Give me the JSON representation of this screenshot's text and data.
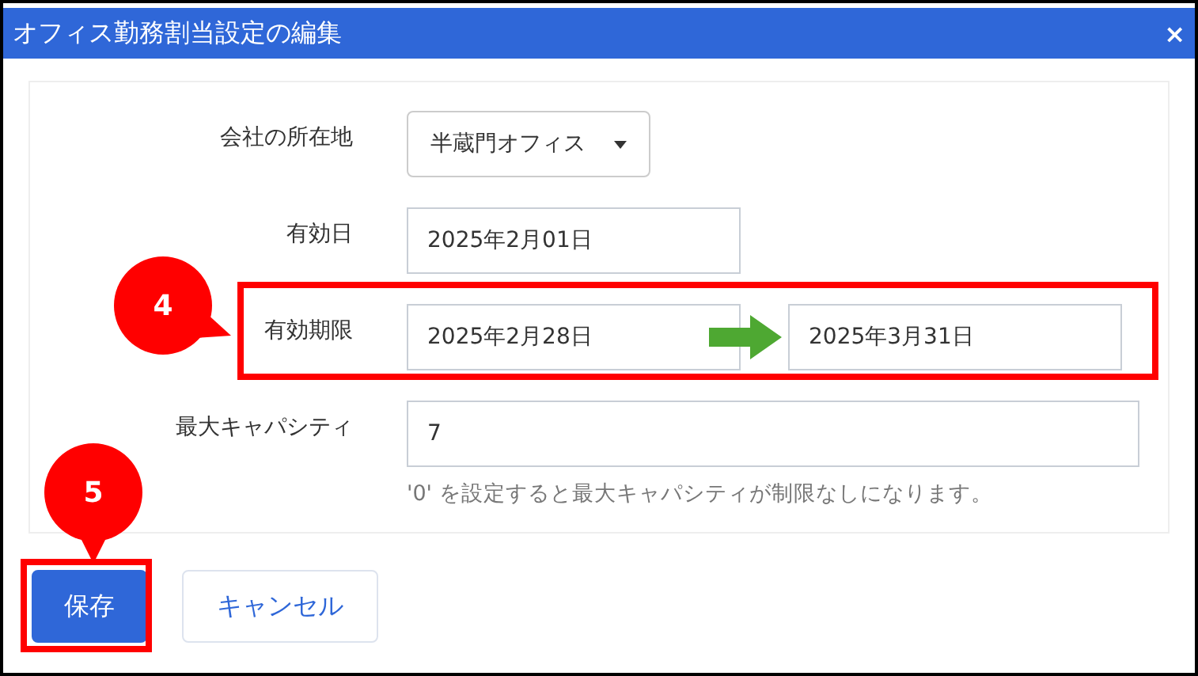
{
  "window": {
    "title": "オフィス勤務割当設定の編集",
    "close": "×"
  },
  "form": {
    "location": {
      "label": "会社の所在地",
      "value": "半蔵門オフィス"
    },
    "effective_date": {
      "label": "有効日",
      "value": "2025年2月01日"
    },
    "expiry": {
      "label": "有効期限",
      "from": "2025年2月28日",
      "to": "2025年3月31日"
    },
    "capacity": {
      "label": "最大キャパシティ",
      "value": "7",
      "help": "'0' を設定すると最大キャパシティが制限なしになります。"
    }
  },
  "buttons": [
    {
      "label": "保存",
      "kind": "primary"
    },
    {
      "label": "キャンセル",
      "kind": "secondary"
    }
  ],
  "callouts": [
    {
      "label": "4"
    },
    {
      "label": "5"
    }
  ]
}
